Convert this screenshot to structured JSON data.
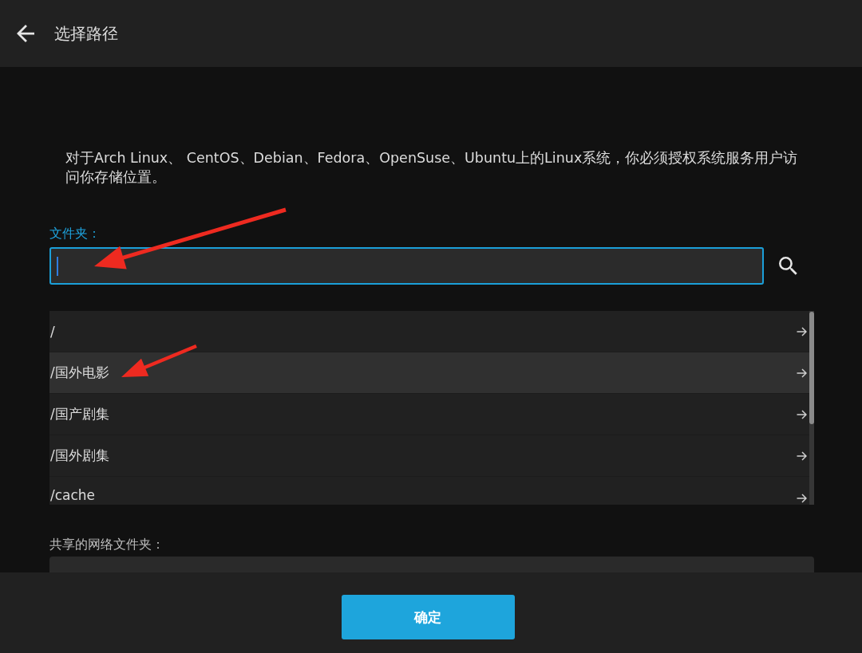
{
  "header": {
    "title": "选择路径"
  },
  "description": "对于Arch Linux、 CentOS、Debian、Fedora、OpenSuse、Ubuntu上的Linux系统，你必须授权系统服务用户访问你存储位置。",
  "folder": {
    "label": "文件夹：",
    "focused": true
  },
  "folders": [
    {
      "path": "/",
      "selected": false
    },
    {
      "path": "/国外电影",
      "selected": true
    },
    {
      "path": "/国产剧集",
      "selected": false
    },
    {
      "path": "/国外剧集",
      "selected": false
    },
    {
      "path": "/cache",
      "selected": false
    }
  ],
  "network_folder": {
    "label": "共享的网络文件夹："
  },
  "footer": {
    "confirm_button": "确定"
  }
}
